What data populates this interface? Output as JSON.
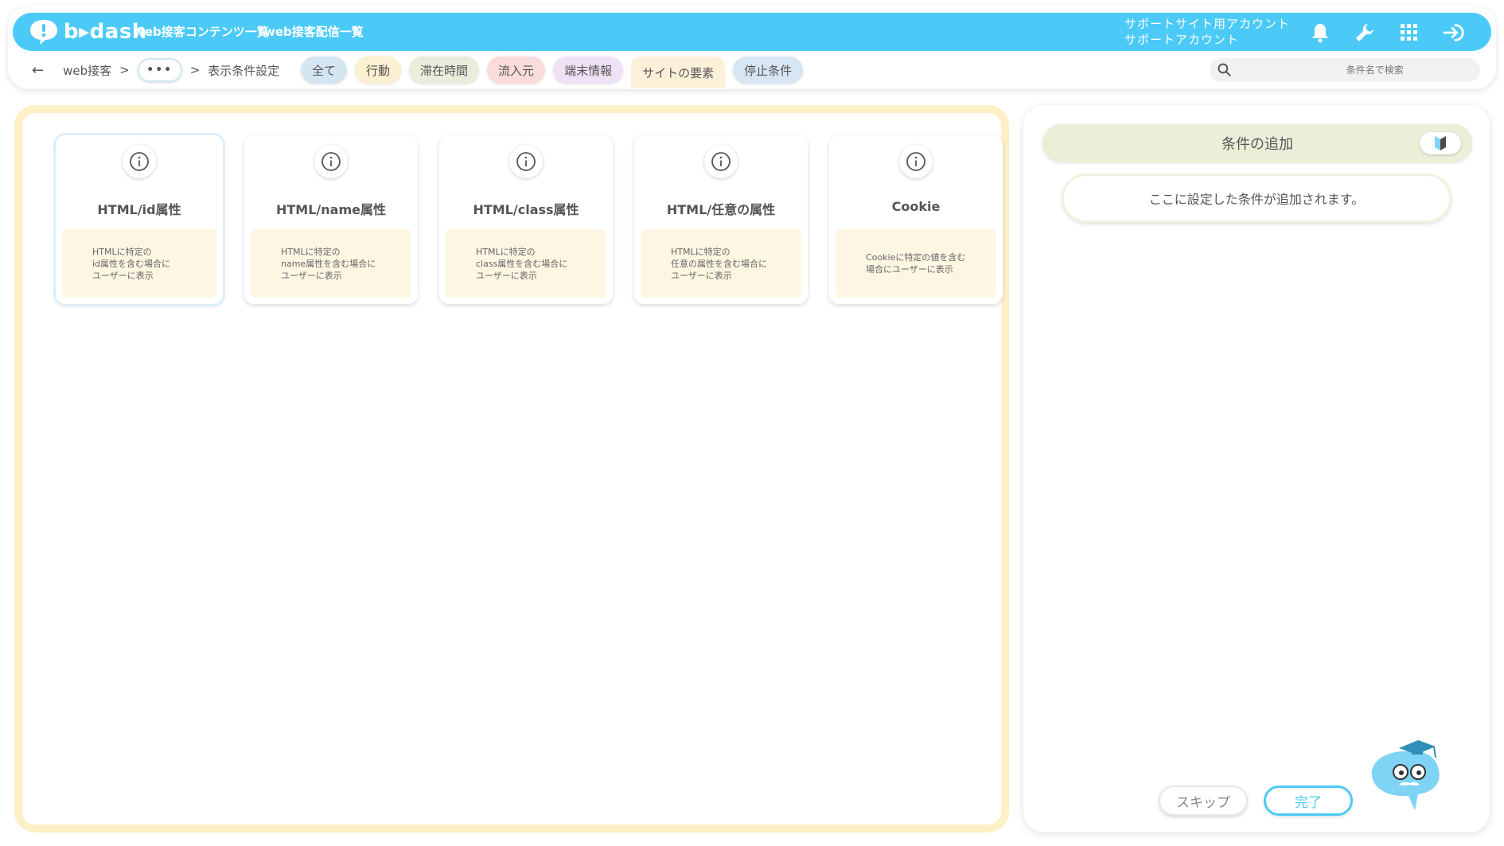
{
  "header": {
    "logo_text": "b▸dash",
    "nav": [
      "web接客コンテンツ一覧",
      "web接客配信一覧"
    ],
    "account_line1": "サポートサイト用アカウント",
    "account_line2": "サポートアカウント",
    "icons": [
      "bell-icon",
      "wrench-icon",
      "grid-icon",
      "logout-icon"
    ]
  },
  "breadcrumb": {
    "root": "web接客",
    "sep": ">",
    "more": "•••",
    "current": "表示条件設定"
  },
  "tabs": [
    {
      "label": "全て",
      "color": "#d5e6f3"
    },
    {
      "label": "行動",
      "color": "#fbf0cf"
    },
    {
      "label": "滞在時間",
      "color": "#e8eedb"
    },
    {
      "label": "流入元",
      "color": "#fbdcdc"
    },
    {
      "label": "端末情報",
      "color": "#f1e1f6"
    },
    {
      "label": "サイトの要素",
      "color": "#fdf0d9"
    },
    {
      "label": "停止条件",
      "color": "#d8e6f4"
    }
  ],
  "active_tab": "サイトの要素",
  "search": {
    "placeholder": "条件名で検索"
  },
  "cards": [
    {
      "title": "HTML/id属性",
      "desc": "HTMLに特定の\nid属性を含む場合に\nユーザーに表示"
    },
    {
      "title": "HTML/name属性",
      "desc": "HTMLに特定の\nname属性を含む場合に\nユーザーに表示"
    },
    {
      "title": "HTML/class属性",
      "desc": "HTMLに特定の\nclass属性を含む場合に\nユーザーに表示"
    },
    {
      "title": "HTML/任意の属性",
      "desc": "HTMLに特定の\n任意の属性を含む場合に\nユーザーに表示"
    },
    {
      "title": "Cookie",
      "desc": "Cookieに特定の値を含む\n場合にユーザーに表示"
    }
  ],
  "conditions": {
    "title": "条件の追加",
    "placeholder": "ここに設定した条件が追加されます。"
  },
  "buttons": {
    "skip": "スキップ",
    "done": "完了"
  },
  "colors": {
    "brand": "#4ccaf7",
    "panel_border": "#fdf0c6",
    "card_desc_bg": "#fdf6e2"
  }
}
